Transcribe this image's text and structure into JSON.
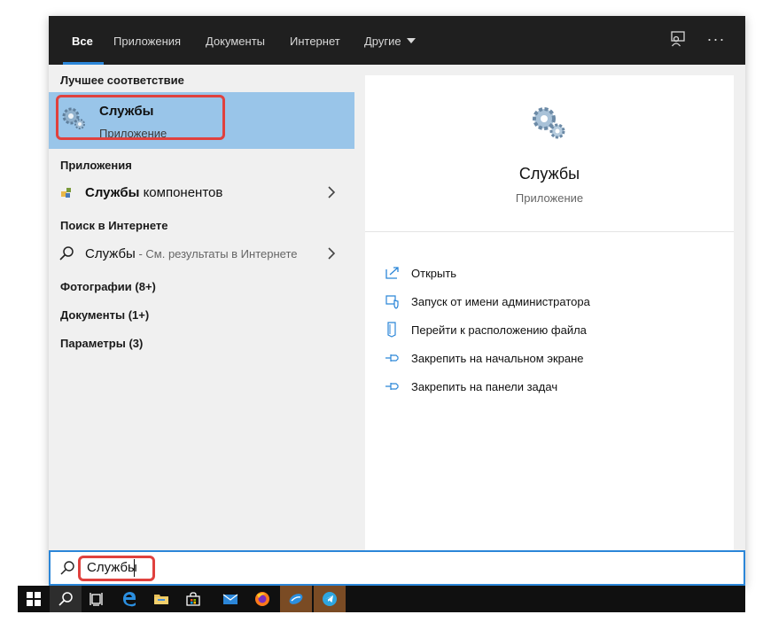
{
  "tabs": [
    "Все",
    "Приложения",
    "Документы",
    "Интернет",
    "Другие"
  ],
  "left": {
    "best_match_label": "Лучшее соответствие",
    "best_match": {
      "title": "Службы",
      "subtitle": "Приложение"
    },
    "apps_label": "Приложения",
    "app_result": {
      "bold": "Службы",
      "rest": " компонентов"
    },
    "web_label": "Поиск в Интернете",
    "web_result": {
      "bold": "Службы",
      "rest": " - См. результаты в Интернете"
    },
    "categories": [
      "Фотографии (8+)",
      "Документы (1+)",
      "Параметры (3)"
    ]
  },
  "right": {
    "title": "Службы",
    "subtitle": "Приложение",
    "actions": [
      "Открыть",
      "Запуск от имени администратора",
      "Перейти к расположению файла",
      "Закрепить на начальном экране",
      "Закрепить на панели задач"
    ]
  },
  "search": {
    "query": "Службы"
  },
  "colors": {
    "accent": "#2b86d8",
    "highlight": "#99c5e9",
    "annotation": "#e0413e"
  }
}
